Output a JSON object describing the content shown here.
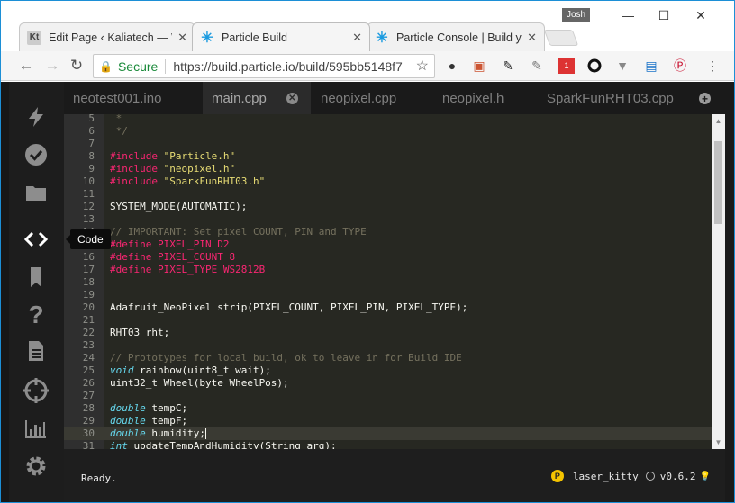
{
  "browser": {
    "profile_name": "Josh",
    "tabs": [
      {
        "favicon": "Kt",
        "label": "Edit Page ‹ Kaliatech — W"
      },
      {
        "favicon": "particle-star-icon",
        "label": "Particle Build"
      },
      {
        "favicon": "particle-star-icon",
        "label": "Particle Console | Build y"
      }
    ],
    "omnibox": {
      "secure_label": "Secure",
      "url": "https://build.particle.io/build/595bb5148f7"
    },
    "extension_badge": "1"
  },
  "ide": {
    "sidebar": {
      "items": [
        "flash-icon",
        "verify-icon",
        "files-icon",
        "code-icon",
        "libraries-icon",
        "help-icon",
        "docs-icon",
        "devices-icon",
        "console-icon",
        "settings-icon"
      ],
      "active": "code-icon",
      "tooltip": "Code"
    },
    "file_tabs": [
      "neotest001.ino",
      "main.cpp",
      "neopixel.cpp",
      "neopixel.h",
      "SparkFunRHT03.cpp"
    ],
    "active_file": "main.cpp",
    "editor": {
      "lines": [
        {
          "n": "5",
          "text": " *"
        },
        {
          "n": "6",
          "text": " */"
        },
        {
          "n": "7",
          "text": ""
        },
        {
          "n": "8",
          "text": "#include \"Particle.h\""
        },
        {
          "n": "9",
          "text": "#include \"neopixel.h\""
        },
        {
          "n": "10",
          "text": "#include \"SparkFunRHT03.h\""
        },
        {
          "n": "11",
          "text": ""
        },
        {
          "n": "12",
          "text": "SYSTEM_MODE(AUTOMATIC);"
        },
        {
          "n": "13",
          "text": ""
        },
        {
          "n": "14",
          "text": "// IMPORTANT: Set pixel COUNT, PIN and TYPE"
        },
        {
          "n": "15",
          "text": "#define PIXEL_PIN D2"
        },
        {
          "n": "16",
          "text": "#define PIXEL_COUNT 8"
        },
        {
          "n": "17",
          "text": "#define PIXEL_TYPE WS2812B"
        },
        {
          "n": "18",
          "text": ""
        },
        {
          "n": "19",
          "text": ""
        },
        {
          "n": "20",
          "text": "Adafruit_NeoPixel strip(PIXEL_COUNT, PIXEL_PIN, PIXEL_TYPE);"
        },
        {
          "n": "21",
          "text": ""
        },
        {
          "n": "22",
          "text": "RHT03 rht;"
        },
        {
          "n": "23",
          "text": ""
        },
        {
          "n": "24",
          "text": "// Prototypes for local build, ok to leave in for Build IDE"
        },
        {
          "n": "25",
          "text": "void rainbow(uint8_t wait);"
        },
        {
          "n": "26",
          "text": "uint32_t Wheel(byte WheelPos);"
        },
        {
          "n": "27",
          "text": ""
        },
        {
          "n": "28",
          "text": "double tempC;"
        },
        {
          "n": "29",
          "text": "double tempF;"
        },
        {
          "n": "30",
          "text": "double humidity;"
        },
        {
          "n": "31",
          "text": "int updateTempAndHumidity(String arg);"
        }
      ],
      "current_line": "30"
    },
    "status": {
      "message": "Ready.",
      "device_badge": "P",
      "device_name": "laser_kitty",
      "firmware": "v0.6.2"
    }
  }
}
